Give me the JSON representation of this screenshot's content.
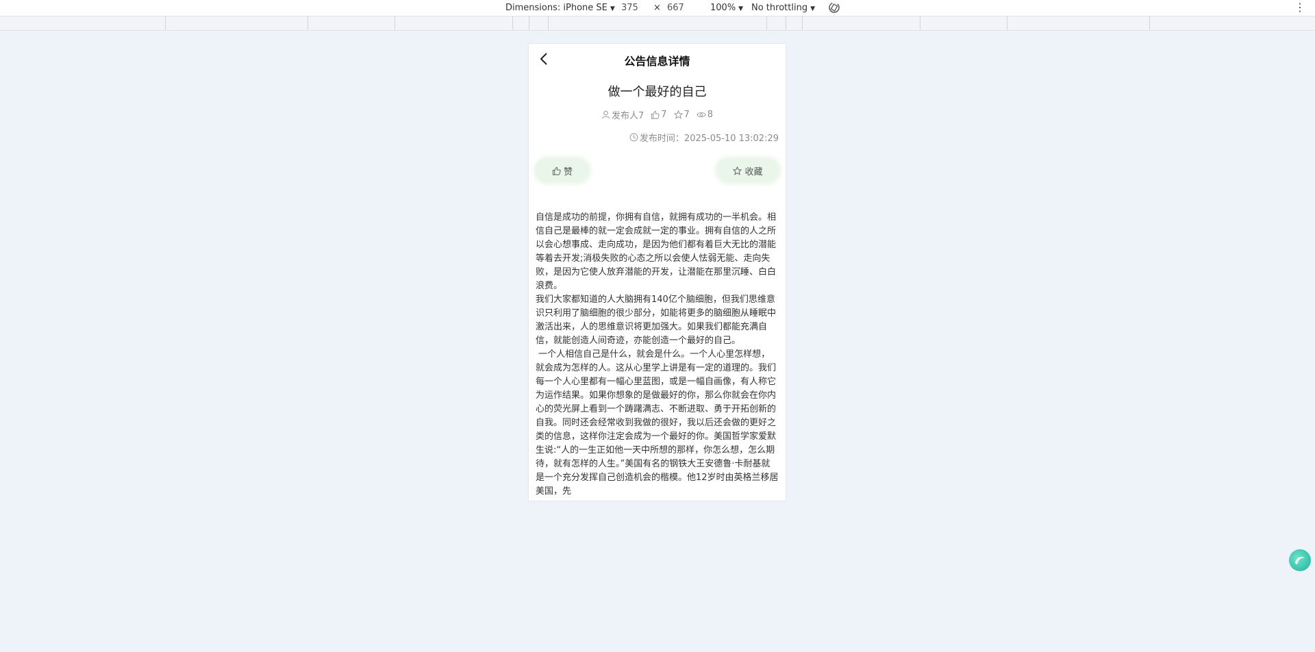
{
  "devtools": {
    "dimensions_label": "Dimensions: iPhone SE",
    "width_value": "375",
    "times_sign": "×",
    "height_value": "667",
    "zoom_label": "100%",
    "throttling_label": "No throttling"
  },
  "page": {
    "nav_title": "公告信息详情",
    "article_title": "做一个最好的自己",
    "meta": {
      "publisher": "发布人7",
      "likes": "7",
      "favorites": "7",
      "views": "8"
    },
    "publish_time": "发布时间：2025-05-10 13:02:29",
    "like_button": "赞",
    "favorite_button": "收藏",
    "paragraphs": [
      "自信是成功的前提，你拥有自信，就拥有成功的一半机会。相信自己是最棒的就一定会成就一定的事业。拥有自信的人之所以会心想事成、走向成功，是因为他们都有着巨大无比的潜能等着去开发;消极失败的心态之所以会使人怯弱无能、走向失败，是因为它使人放弃潜能的开发，让潜能在那里沉睡、白白浪费。",
      "我们大家都知道的人大脑拥有140亿个脑细胞，但我们思维意识只利用了脑细胞的很少部分，如能将更多的脑细胞从睡眠中激活出来，人的思维意识将更加强大。如果我们都能充满自信，就能创造人间奇迹，亦能创造一个最好的自己。",
      " 一个人相信自己是什么，就会是什么。一个人心里怎样想，就会成为怎样的人。这从心里学上讲是有一定的道理的。我们每一个人心里都有一幅心里蓝图，或是一幅自画像，有人称它为运作结果。如果你想象的是做最好的你，那么你就会在你内心的荧光屏上看到一个踌躇满志、不断进取、勇于开拓创新的自我。同时还会经常收到我做的很好，我以后还会做的更好之类的信息，这样你注定会成为一个最好的你。美国哲学家爱默生说:“人的一生正如他一天中所想的那样，你怎么想，怎么期待，就有怎样的人生。”美国有名的钢铁大王安德鲁·卡耐基就是一个充分发挥自己创造机会的楷模。他12岁时由英格兰移居美国，先"
    ]
  }
}
